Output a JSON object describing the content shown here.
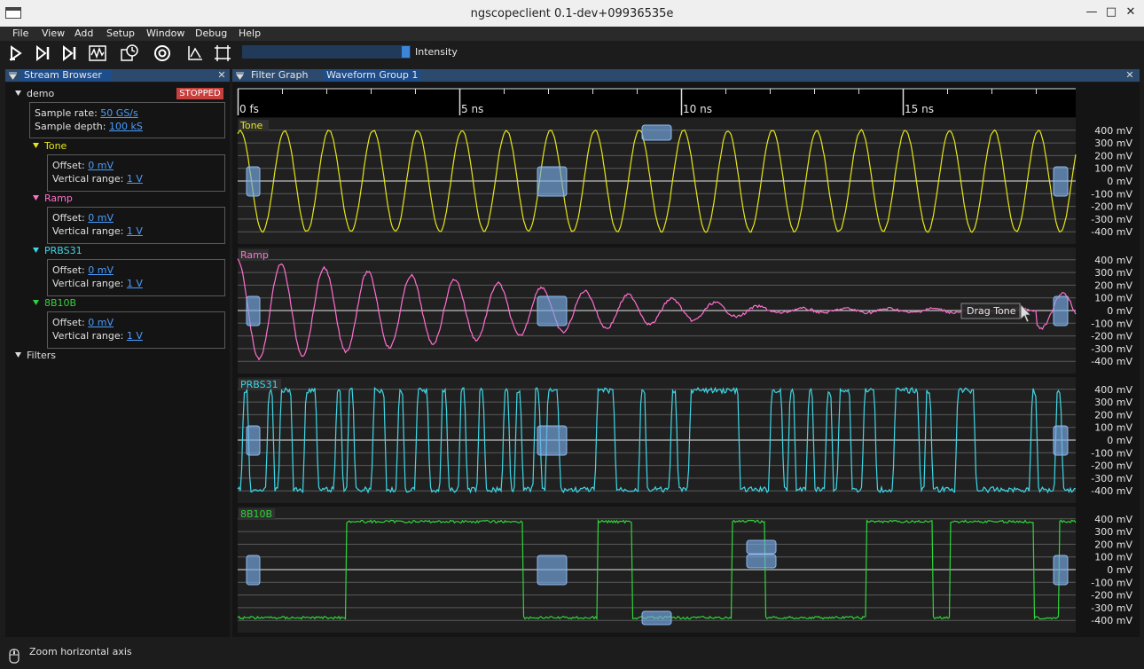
{
  "window": {
    "title": "ngscopeclient 0.1-dev+09936535e"
  },
  "menu": [
    "File",
    "View",
    "Add",
    "Setup",
    "Window",
    "Debug",
    "Help"
  ],
  "toolbar": {
    "icons": [
      "arm-trigger-icon",
      "single-trigger-icon",
      "force-trigger-icon",
      "waveform-icon",
      "history-icon",
      "timebase-icon",
      "measure-icon",
      "fullscreen-icon"
    ],
    "intensity_label": "Intensity",
    "intensity_value": 0.95
  },
  "stream_browser": {
    "tab_label": "Stream Browser",
    "instrument": "demo",
    "status": "STOPPED",
    "sample_rate_label": "Sample rate:",
    "sample_rate_value": "50 GS/s",
    "sample_depth_label": "Sample depth:",
    "sample_depth_value": "100 kS",
    "offset_label": "Offset:",
    "vrange_label": "Vertical range:",
    "channels": [
      {
        "name": "Tone",
        "color": "#e6e619",
        "offset": "0 mV",
        "vrange": "1 V"
      },
      {
        "name": "Ramp",
        "color": "#ff6fcf",
        "offset": "0 mV",
        "vrange": "1 V"
      },
      {
        "name": "PRBS31",
        "color": "#3fd7e6",
        "offset": "0 mV",
        "vrange": "1 V"
      },
      {
        "name": "8B10B",
        "color": "#2fd43a",
        "offset": "0 mV",
        "vrange": "1 V"
      }
    ],
    "filters_label": "Filters"
  },
  "tabs": {
    "filter_graph": "Filter Graph",
    "waveform_group": "Waveform Group 1"
  },
  "timeline": {
    "ticks": [
      "0 fs",
      "5 ns",
      "10 ns",
      "15 ns"
    ]
  },
  "y_axis": [
    "400 mV",
    "300 mV",
    "200 mV",
    "100 mV",
    "0 mV",
    "-100 mV",
    "-200 mV",
    "-300 mV",
    "-400 mV"
  ],
  "plots": [
    {
      "label": "Tone",
      "color": "#e6e619"
    },
    {
      "label": "Ramp",
      "color": "#ff6fcf"
    },
    {
      "label": "PRBS31",
      "color": "#3fd7e6"
    },
    {
      "label": "8B10B",
      "color": "#2fd43a"
    }
  ],
  "tooltip": "Drag Tone",
  "status_bar": {
    "text": "Zoom horizontal axis"
  }
}
